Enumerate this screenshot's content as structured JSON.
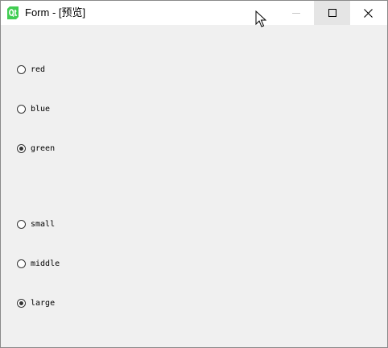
{
  "window": {
    "title": "Form - [预览]"
  },
  "icons": {
    "app": "qt-logo-icon",
    "minimize": "minimize-icon",
    "maximize": "maximize-icon",
    "close": "close-icon",
    "cursor": "mouse-cursor-icon"
  },
  "colors": {
    "titlebar_bg": "#ffffff",
    "client_bg": "#f0f0f0",
    "qt_green": "#41cd52",
    "radio_border": "#333333"
  },
  "color_group": {
    "options": [
      {
        "label": "red",
        "checked": false
      },
      {
        "label": "blue",
        "checked": false
      },
      {
        "label": "green",
        "checked": true
      }
    ]
  },
  "size_group": {
    "options": [
      {
        "label": "small",
        "checked": false
      },
      {
        "label": "middle",
        "checked": false
      },
      {
        "label": "large",
        "checked": true
      }
    ]
  }
}
